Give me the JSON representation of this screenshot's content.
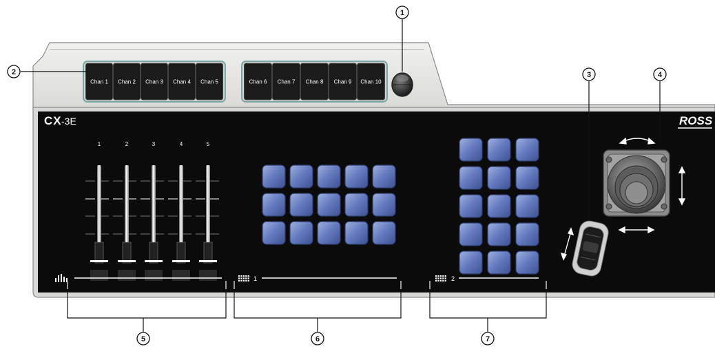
{
  "brand": {
    "model_prefix": "CX",
    "model_suffix": "-3E",
    "maker": "ROSS"
  },
  "channel_groups": [
    {
      "labels": [
        "Chan 1",
        "Chan 2",
        "Chan 3",
        "Chan 4",
        "Chan 5"
      ]
    },
    {
      "labels": [
        "Chan 6",
        "Chan 7",
        "Chan 8",
        "Chan 9",
        "Chan 10"
      ]
    }
  ],
  "faders": {
    "labels": [
      "1",
      "2",
      "3",
      "4",
      "5"
    ],
    "levels": [
      1.0,
      1.0,
      1.0,
      1.0,
      1.0
    ]
  },
  "keypads": [
    {
      "label": "1",
      "rows": 3,
      "cols": 5
    },
    {
      "label": "2",
      "rows": 5,
      "cols": 3
    }
  ],
  "callouts": [
    "1",
    "2",
    "3",
    "4",
    "5",
    "6",
    "7"
  ],
  "colors": {
    "panel": "#0b0b0b",
    "shell": "#e6e6e4",
    "key_blue": "#5b72b8",
    "key_highlight": "#9fb0e0",
    "channel_key": "#1b1b1b"
  }
}
